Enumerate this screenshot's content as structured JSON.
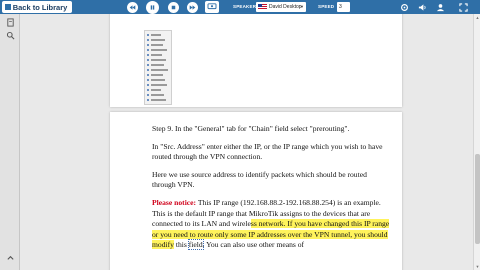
{
  "toolbar": {
    "back_label": "Back to Library",
    "speaker_label": "SPEAKER",
    "voice_value": "David Desktop",
    "speed_label": "SPEED",
    "speed_value": "3",
    "colors": {
      "bar": "#2f6fa7",
      "highlight": "#fff35c",
      "notice": "#d0021b"
    }
  },
  "document": {
    "step9": "Step 9. In the \"General\" tab for \"Chain\" field select \"prerouting\".",
    "src_address": "In \"Src. Address\" enter either the IP, or the IP range which you wish to have routed through the VPN connection.",
    "here_text": "Here we use source address to identify packets which should be routed through VPN.",
    "notice_label": "Please notice:",
    "notice_plain": " This IP range (192.168.88.2-192.168.88.254) is an example. This is the default IP range that MikroTik assigns to the devices that are connected to its LAN and wirele",
    "notice_highlight": "ss network. If you have changed this IP range or you need to route only some IP addresses over the VPN tunnel, you should modify",
    "notice_this": " this ",
    "notice_field": "field",
    "notice_tail": ". You can also use other means of"
  },
  "icons": [
    "back-grid-icon",
    "rewind-icon",
    "play-icon",
    "pause-icon",
    "stop-icon",
    "fast-forward-icon",
    "speech-settings-icon",
    "settings-icon",
    "volume-icon",
    "fullscreen-icon",
    "search-icon",
    "expand-icon"
  ]
}
